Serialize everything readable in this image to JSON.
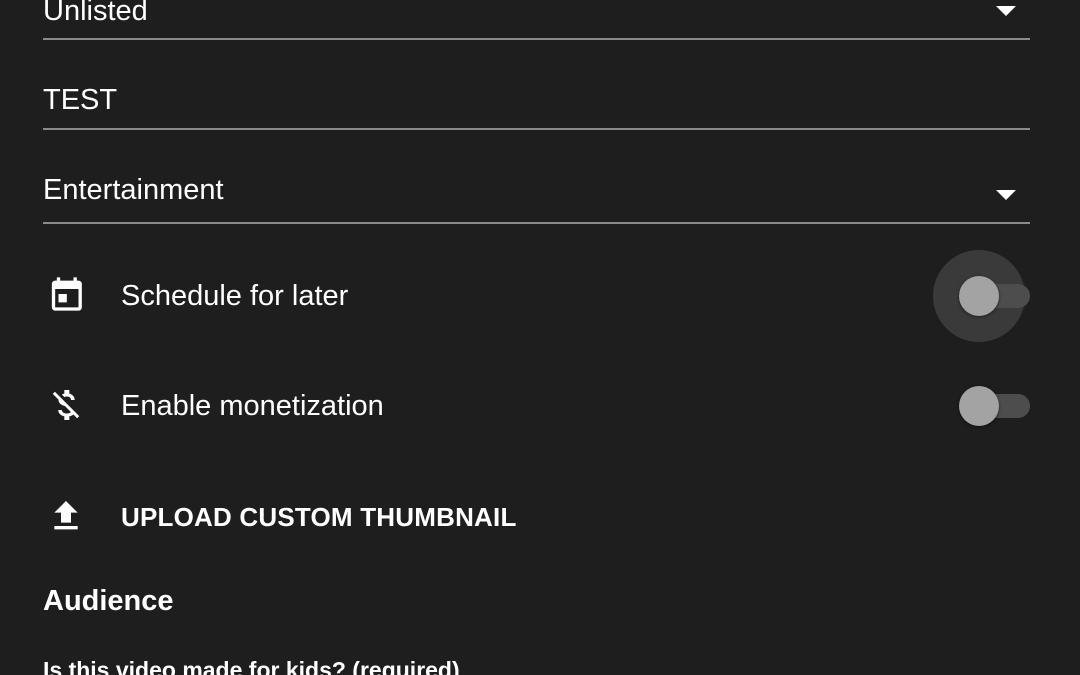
{
  "fields": {
    "visibility": {
      "value": "Unlisted"
    },
    "title": {
      "value": "TEST"
    },
    "category": {
      "value": "Entertainment"
    }
  },
  "options": {
    "schedule": {
      "label": "Schedule for later",
      "enabled": false,
      "icon": "calendar-icon"
    },
    "monetization": {
      "label": "Enable monetization",
      "enabled": false,
      "icon": "money-off-icon"
    },
    "thumbnail": {
      "label": "UPLOAD CUSTOM THUMBNAIL",
      "icon": "upload-icon"
    }
  },
  "audience": {
    "heading": "Audience",
    "question": "Is this video made for kids? (required)"
  },
  "colors": {
    "background": "#1e1e1e",
    "text": "#ffffff",
    "divider": "#8a8a8a",
    "toggle_off_knob": "#a3a3a3",
    "toggle_off_track": "#4d4d4d"
  }
}
